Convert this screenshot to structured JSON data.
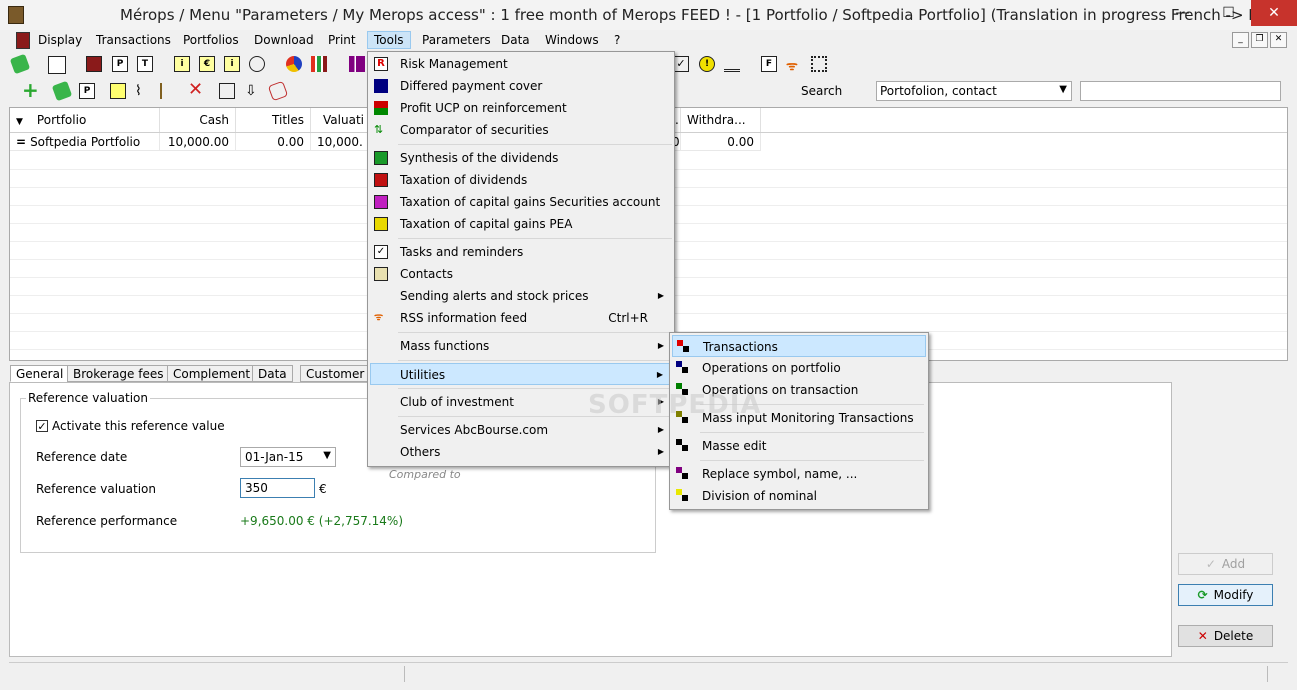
{
  "window": {
    "title": "Mérops / Menu \"Parameters / My Merops access\" : 1 free month of Merops FEED ! - [1 Portfolio / Softpedia Portfolio] (Translation in progress French -> English)",
    "minimize": "—",
    "maximize": "☐",
    "close": "✕"
  },
  "menubar": [
    "Display",
    "Transactions",
    "Portfolios",
    "Download",
    "Print",
    "Tools",
    "Parameters",
    "Data",
    "Windows",
    "?"
  ],
  "mdi": {
    "minimize": "_",
    "restore": "❐",
    "close": "✕"
  },
  "search": {
    "label": "Search",
    "combo_value": "Portofolion, contact"
  },
  "grid": {
    "columns": [
      "Portfolio",
      "Cash",
      "Titles",
      "Valuati",
      "Withdra..."
    ],
    "row": {
      "portfolio": "Softpedia Portfolio",
      "cash": "10,000.00",
      "titles": "0.00",
      "valuation": "10,000.",
      "hidden_tail": "0",
      "withdrawals": "0.00"
    },
    "dot": "."
  },
  "tabs": [
    "General",
    "Brokerage fees",
    "Complement",
    "Data",
    "Customer"
  ],
  "reference": {
    "group_title": "Reference valuation",
    "activate_label": "Activate this reference value",
    "check_mark": "✓",
    "date_label": "Reference date",
    "date_value": "01-Jan-15",
    "valuation_label": "Reference valuation",
    "valuation_value": "350",
    "currency": "€",
    "performance_label": "Reference performance",
    "performance_value": "+9,650.00 € (+2,757.14%)",
    "compared_to": "Compared to"
  },
  "buttons": {
    "add": "Add",
    "modify": "Modify",
    "delete": "Delete"
  },
  "tools_menu": [
    {
      "label": "Risk Management"
    },
    {
      "label": "Differed payment cover"
    },
    {
      "label": "Profit UCP on reinforcement"
    },
    {
      "label": "Comparator of securities"
    },
    {
      "label": "Synthesis of the dividends"
    },
    {
      "label": "Taxation of dividends"
    },
    {
      "label": "Taxation of capital gains Securities account"
    },
    {
      "label": "Taxation of capital gains PEA"
    },
    {
      "label": "Tasks and reminders"
    },
    {
      "label": "Contacts"
    },
    {
      "label": "Sending alerts and stock prices"
    },
    {
      "label": "RSS information feed",
      "shortcut": "Ctrl+R"
    },
    {
      "label": "Mass functions"
    },
    {
      "label": "Utilities"
    },
    {
      "label": "Club of investment"
    },
    {
      "label": "Services AbcBourse.com"
    },
    {
      "label": "Others"
    }
  ],
  "utilities_menu": [
    {
      "label": "Transactions",
      "color": "#e00000"
    },
    {
      "label": "Operations on portfolio",
      "color": "#000080"
    },
    {
      "label": "Operations on transaction",
      "color": "#008000"
    },
    {
      "label": "Mass input Monitoring Transactions",
      "color": "#808000"
    },
    {
      "label": "Masse edit",
      "color": "#000000"
    },
    {
      "label": "Replace symbol, name, ...",
      "color": "#800080"
    },
    {
      "label": "Division of nominal",
      "color": "#e8e800"
    }
  ],
  "submenu_arrow": "▶",
  "watermark": "SOFTPEDIA"
}
